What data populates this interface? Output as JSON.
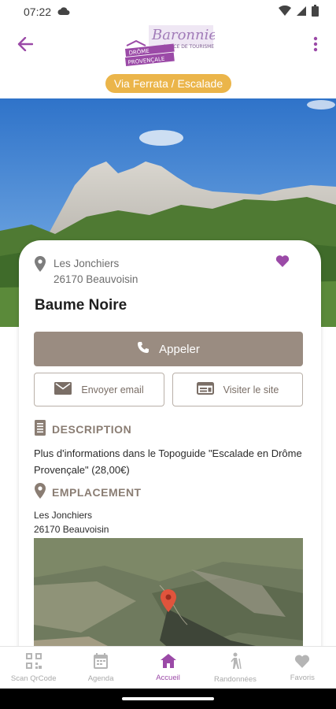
{
  "status_bar": {
    "time": "07:22"
  },
  "header": {
    "logo_text": "Baronnies",
    "logo_tagline": "OFFICE DE TOURISME",
    "logo_subtitle_1": "DRÔME",
    "logo_subtitle_2": "PROVENÇALE",
    "category": "Via Ferrata / Escalade"
  },
  "listing": {
    "address_line1": "Les Jonchiers",
    "address_line2": "26170 Beauvoisin",
    "title": "Baume Noire",
    "call_label": "Appeler",
    "email_label": "Envoyer email",
    "website_label": "Visiter le site",
    "description_heading": "DESCRIPTION",
    "description_text": "Plus d'informations dans le Topoguide \"Escalade en Drôme Provençale\" (28,00€)",
    "location_heading": "EMPLACEMENT",
    "location_line1": "Les Jonchiers",
    "location_line2": "26170  Beauvoisin"
  },
  "bottom_nav": [
    {
      "label": "Scan QrCode",
      "icon": "qr-code-icon"
    },
    {
      "label": "Agenda",
      "icon": "calendar-icon"
    },
    {
      "label": "Accueil",
      "icon": "home-icon",
      "active": true
    },
    {
      "label": "Randonnées",
      "icon": "hiker-icon"
    },
    {
      "label": "Favoris",
      "icon": "heart-icon"
    }
  ],
  "colors": {
    "accent_purple": "#9b4aa7",
    "category_pill": "#ebb54a",
    "primary_button": "#9a8c81",
    "map_pin": "#e0543c"
  }
}
